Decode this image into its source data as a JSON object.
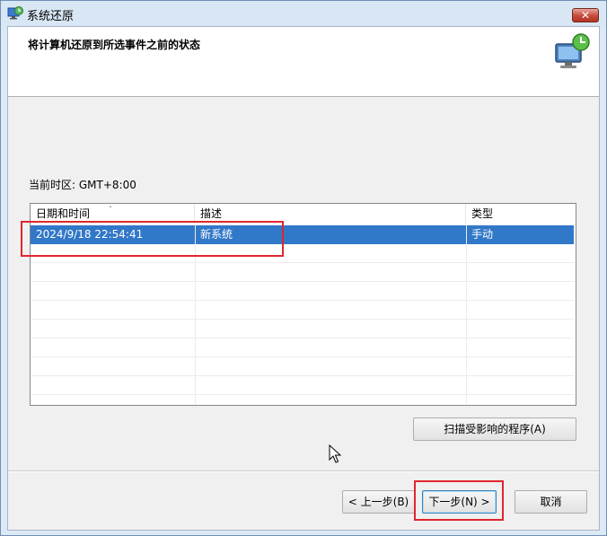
{
  "window": {
    "title": "系统还原",
    "close_label": "✕"
  },
  "header": {
    "instruction": "将计算机还原到所选事件之前的状态",
    "icon": "system-restore-monitor-icon"
  },
  "timezone_label": "当前时区: GMT+8:00",
  "table": {
    "sort_indicator": "ˇ",
    "columns": [
      "日期和时间",
      "描述",
      "类型"
    ],
    "rows": [
      {
        "datetime": "2024/9/18 22:54:41",
        "description": "新系统",
        "type": "手动",
        "selected": true
      }
    ]
  },
  "buttons": {
    "scan": "扫描受影响的程序(A)",
    "back": "< 上一步(B)",
    "next": "下一步(N) >",
    "cancel": "取消"
  },
  "colors": {
    "selection": "#3278c8",
    "highlight_box": "#e0262f",
    "desktop": "#1a69b8"
  }
}
